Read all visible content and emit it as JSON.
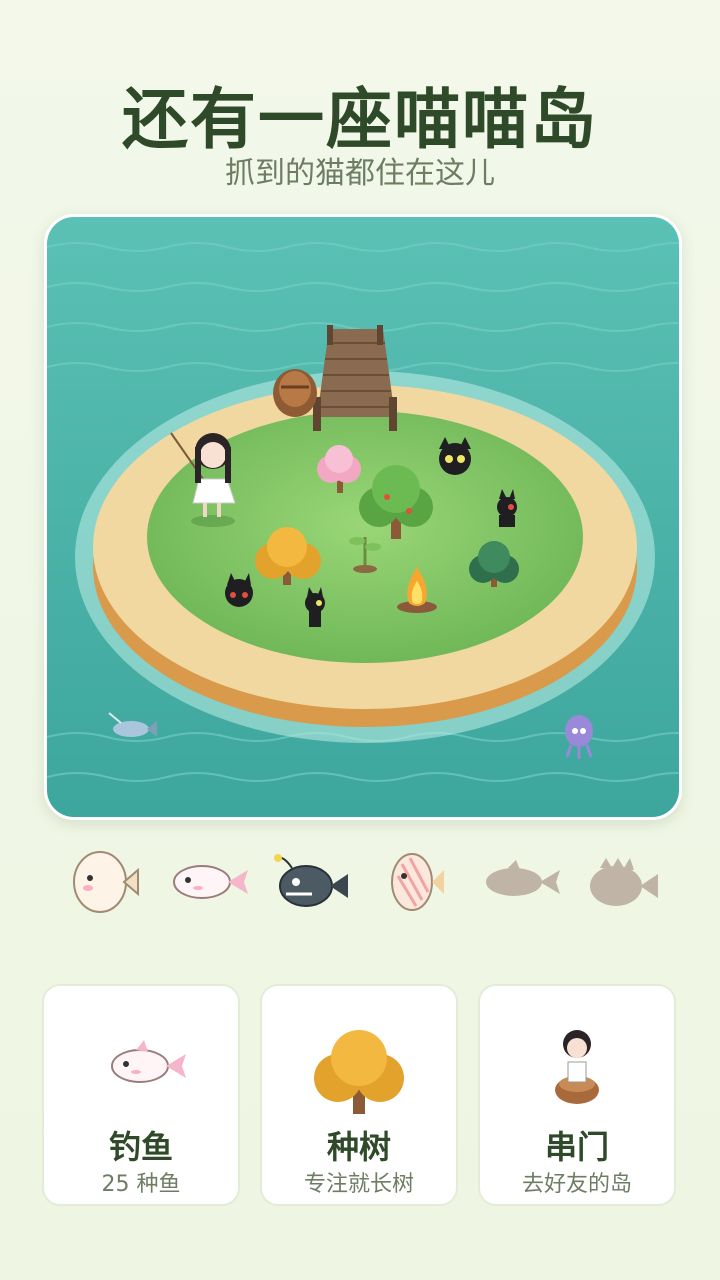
{
  "header": {
    "title": "还有一座喵喵岛",
    "subtitle": "抓到的猫都住在这儿"
  },
  "scene": {
    "description_icons": [
      "island",
      "dock",
      "rowboat",
      "girl-fishing",
      "black-cat",
      "pink-tree",
      "apple-tree",
      "orange-tree",
      "green-bush",
      "sapling",
      "campfire",
      "swordfish",
      "squid"
    ]
  },
  "fish_collection": [
    {
      "icon": "round-white-fish-icon",
      "collected": true
    },
    {
      "icon": "axolotl-fish-icon",
      "collected": true
    },
    {
      "icon": "anglerfish-icon",
      "collected": true
    },
    {
      "icon": "striped-fish-icon",
      "collected": true
    },
    {
      "icon": "locked-fish-silhouette-icon",
      "collected": false
    },
    {
      "icon": "locked-fish-silhouette-icon",
      "collected": false
    }
  ],
  "cards": [
    {
      "title": "钓鱼",
      "subtitle": "25 种鱼",
      "icon": "axolotl-fish-icon"
    },
    {
      "title": "种树",
      "subtitle": "专注就长树",
      "icon": "orange-tree-icon"
    },
    {
      "title": "串门",
      "subtitle": "去好友的岛",
      "icon": "girl-in-boat-icon"
    }
  ],
  "colors": {
    "title": "#2f4a28",
    "sea": "#4fb5ac",
    "grass": "#7fc465",
    "sand": "#f1d8a0"
  }
}
